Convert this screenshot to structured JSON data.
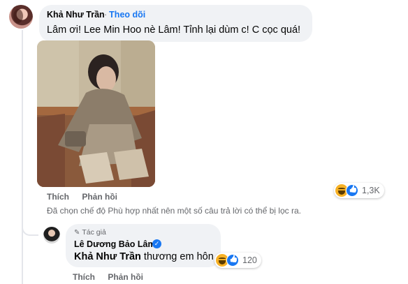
{
  "comment": {
    "author": "Khả Như Trần",
    "follow_label": "Theo dõi",
    "separator": "·",
    "text": "Lâm ơi! Lee Min Hoo nè Lâm! Tỉnh lại dùm c! C cọc quá!",
    "actions": {
      "like": "Thích",
      "reply": "Phản hồi"
    },
    "reactions": {
      "icons": [
        "haha-icon",
        "like-icon"
      ],
      "count": "1,3K"
    }
  },
  "filter_notice": "Đã chọn chế độ Phù hợp nhất nên một số câu trả lời có thể bị lọc ra.",
  "reply": {
    "badge": "Tác giả",
    "author": "Lê Dương Bảo Lâm",
    "mention": "Khả Như Trần",
    "text": " thương em hôn",
    "actions": {
      "like": "Thích",
      "reply": "Phản hồi"
    },
    "reactions": {
      "icons": [
        "haha-icon",
        "like-icon"
      ],
      "count": "120"
    }
  },
  "colors": {
    "bubble": "#f0f2f5",
    "accent": "#1877f2",
    "muted": "#65676b",
    "haha": "#f7b125"
  }
}
